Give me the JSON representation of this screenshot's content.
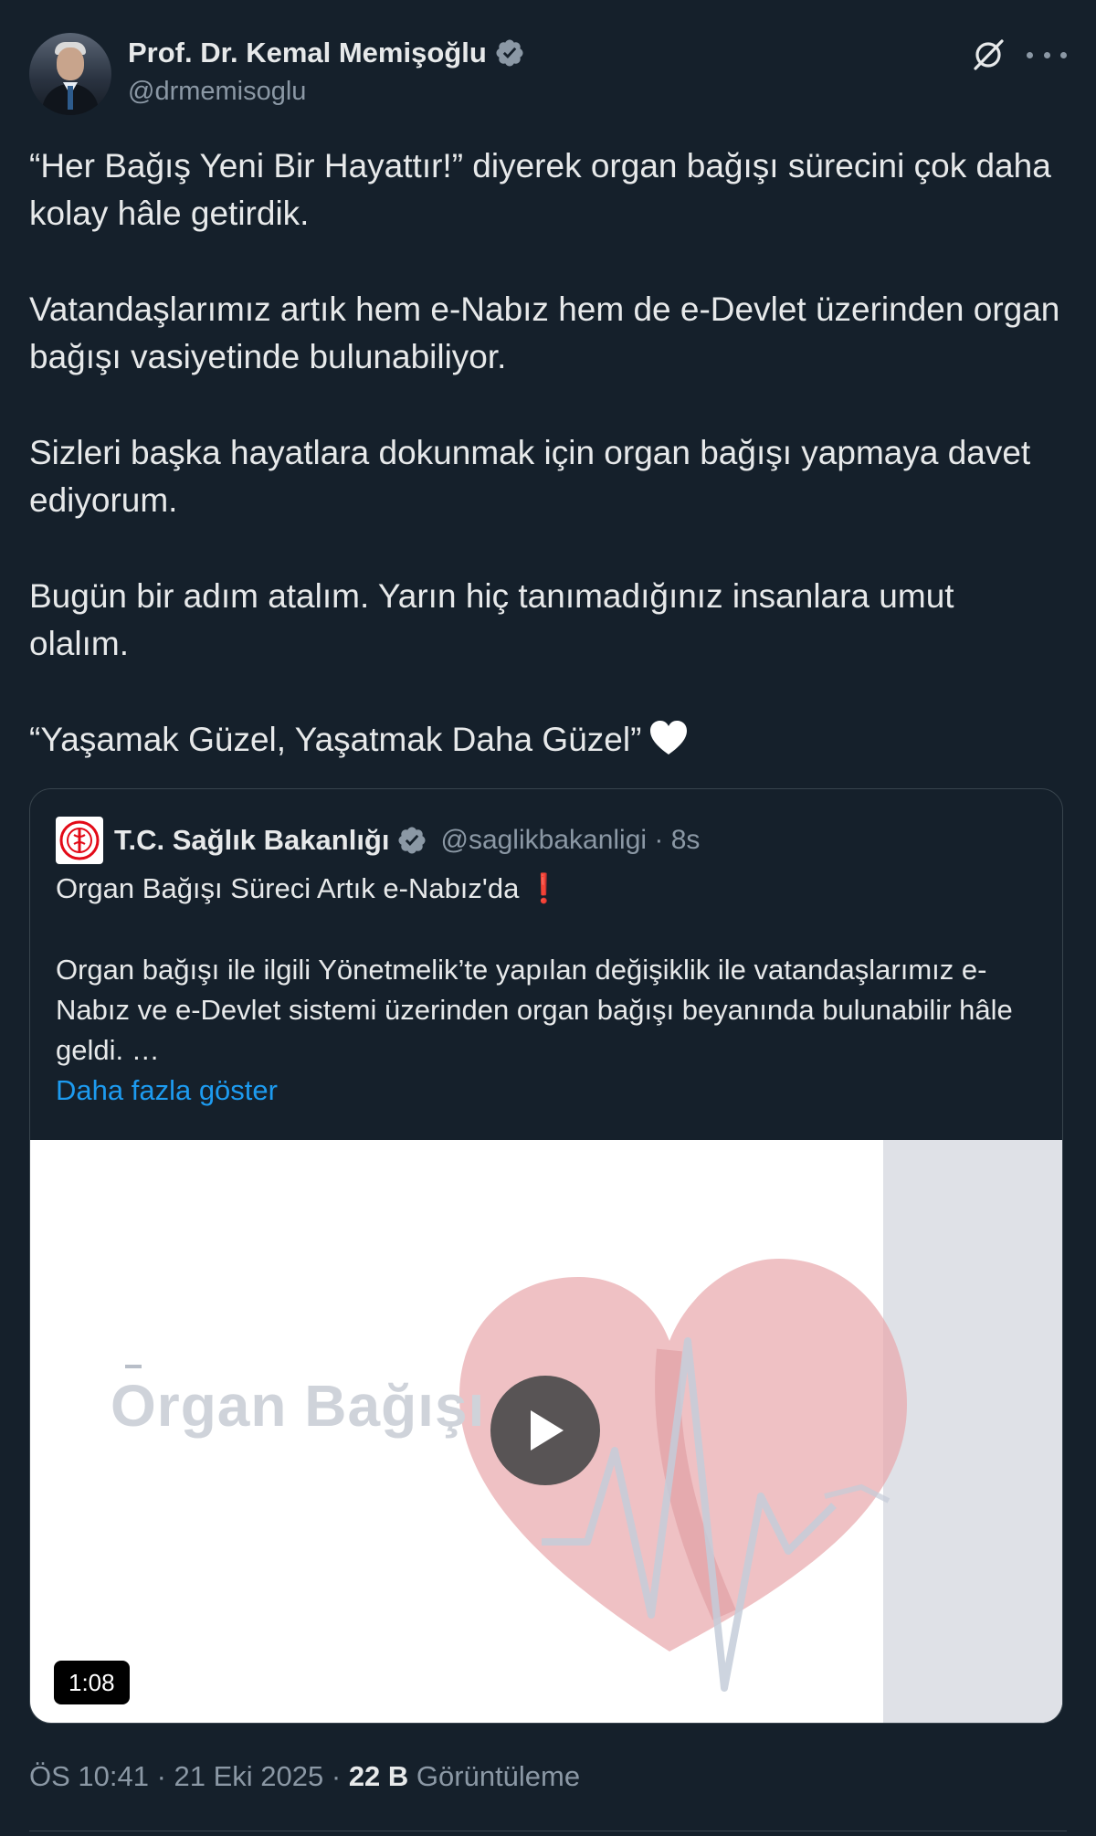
{
  "author": {
    "display_name": "Prof. Dr. Kemal Memişoğlu",
    "handle": "@drmemisoglu"
  },
  "body": {
    "paragraphs": [
      "“Her Bağış Yeni Bir Hayattır!” diyerek organ bağışı sürecini çok daha kolay hâle getirdik.",
      "Vatandaşlarımız artık hem e-Nabız hem de e-Devlet üzerinden organ bağışı vasiyetinde bulunabiliyor.",
      "Sizleri başka hayatlara dokunmak için organ bağışı yapmaya davet ediyorum.",
      "Bugün bir adım atalım. Yarın hiç tanımadığınız insanlara umut olalım.",
      "“Yaşamak Güzel, Yaşatmak Daha Güzel”"
    ]
  },
  "quote": {
    "display_name": "T.C. Sağlık Bakanlığı",
    "meta": "@saglikbakanligi · 8s",
    "title": "Organ Bağışı Süreci Artık e-Nabız'da",
    "title_emoji": "❗",
    "body": "Organ bağışı ile ilgili Yönetmelik’te yapılan değişiklik ile vatandaşlarımız e-Nabız ve e-Devlet sistemi üzerinden organ bağışı beyanında bulunabilir hâle geldi. …",
    "show_more": "Daha fazla göster",
    "video": {
      "overlay_text": "Organ Bağışı",
      "duration": "1:08"
    }
  },
  "footer": {
    "time_date": "ÖS 10:41 · 21 Eki 2025 · ",
    "views_count": "22 B",
    "views_label": " Görüntüleme"
  },
  "colors": {
    "background": "#15202b",
    "text_primary": "#e7e9ea",
    "text_secondary": "#8b98a5",
    "link": "#1d9bf0",
    "verified_badge": "#8b98a5",
    "border": "#38444d"
  },
  "icons": {
    "verified": "verified-badge-icon",
    "grok": "grok-icon",
    "more": "more-options-icon",
    "heart": "white-heart-icon",
    "play": "play-icon"
  }
}
